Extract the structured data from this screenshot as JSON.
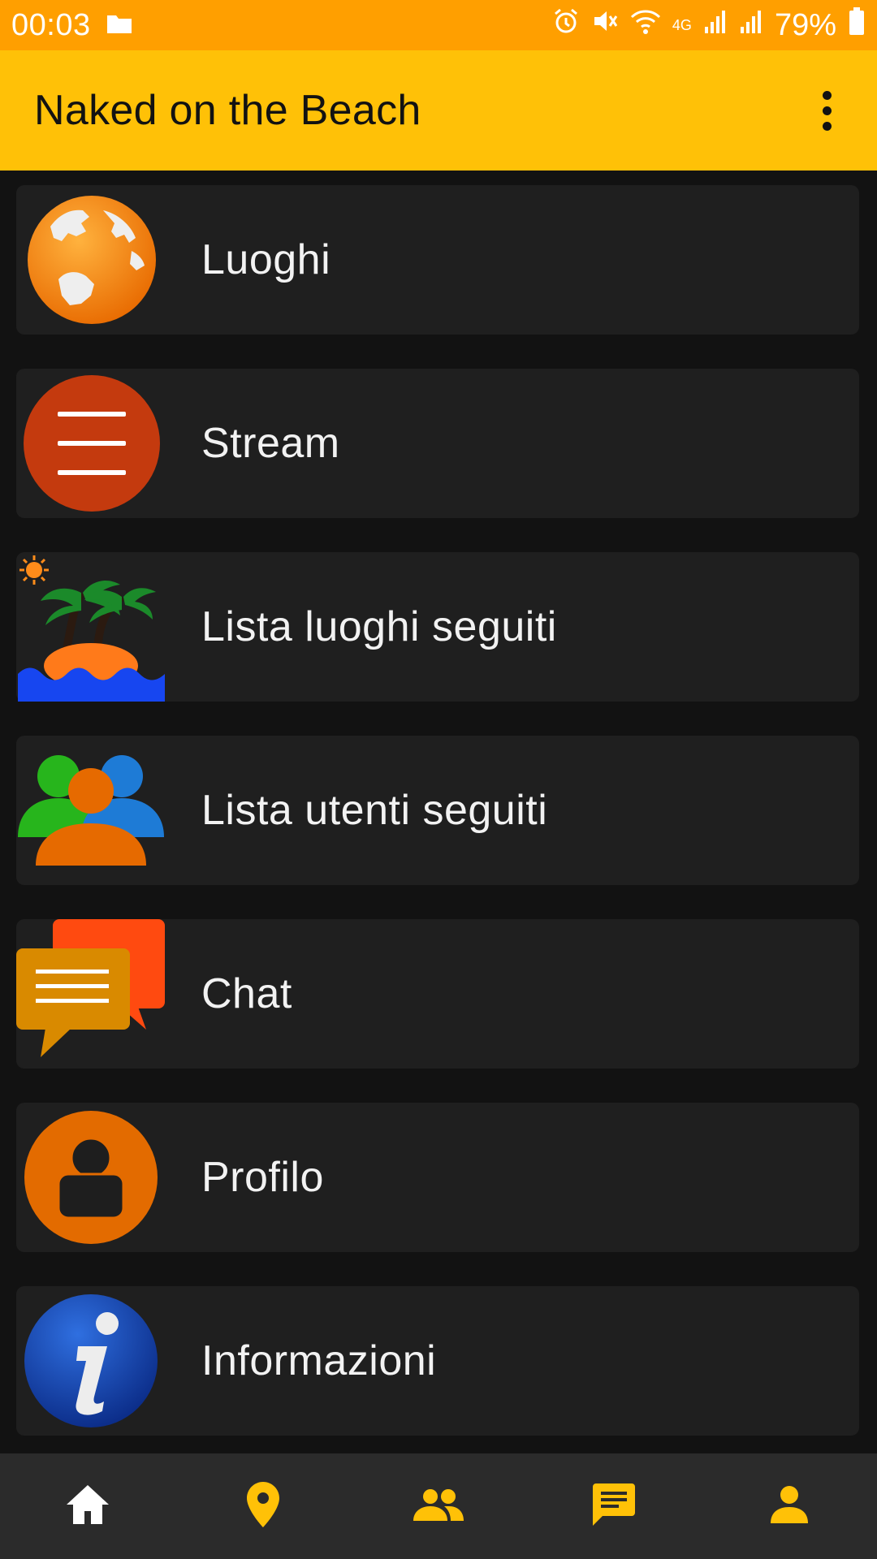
{
  "status_bar": {
    "time": "00:03",
    "battery": "79%",
    "network": "4G"
  },
  "app_bar": {
    "title": "Naked on the Beach",
    "menu_icon": "more-vert-icon"
  },
  "menu": [
    {
      "id": "luoghi",
      "label": "Luoghi",
      "icon": "globe-icon"
    },
    {
      "id": "stream",
      "label": "Stream",
      "icon": "stream-icon"
    },
    {
      "id": "luoghi-seguiti",
      "label": "Lista luoghi seguiti",
      "icon": "island-icon"
    },
    {
      "id": "utenti-seguiti",
      "label": "Lista utenti seguiti",
      "icon": "users-icon"
    },
    {
      "id": "chat",
      "label": "Chat",
      "icon": "chat-icon"
    },
    {
      "id": "profilo",
      "label": "Profilo",
      "icon": "profile-icon"
    },
    {
      "id": "informazioni",
      "label": "Informazioni",
      "icon": "info-icon"
    }
  ],
  "bottom_nav": [
    {
      "id": "home",
      "icon": "home-icon",
      "active": true
    },
    {
      "id": "places",
      "icon": "location-pin-icon",
      "active": false
    },
    {
      "id": "people",
      "icon": "people-icon",
      "active": false
    },
    {
      "id": "messages",
      "icon": "message-icon",
      "active": false
    },
    {
      "id": "account",
      "icon": "person-icon",
      "active": false
    }
  ],
  "colors": {
    "status_bar": "#FF9F00",
    "app_bar": "#FFC107",
    "background": "#121212",
    "card": "#1F1F1F",
    "nav_active": "#FFFFFF",
    "nav_inactive": "#FFC107"
  }
}
